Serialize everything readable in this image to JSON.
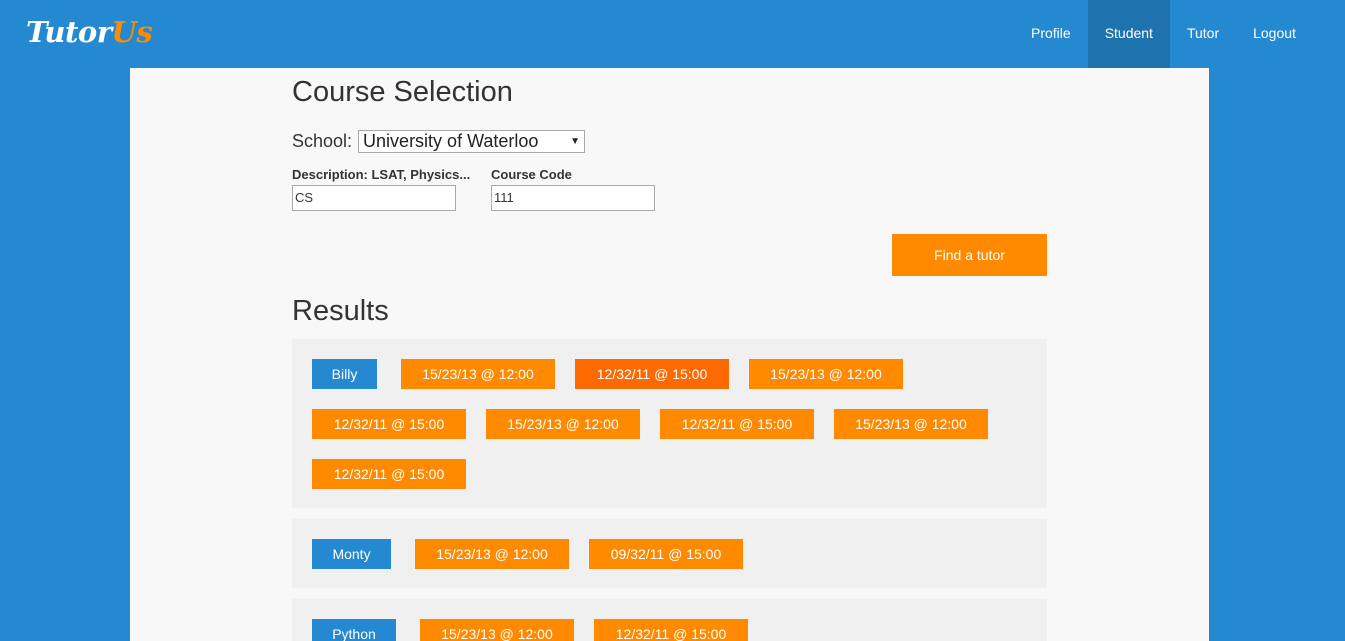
{
  "header": {
    "logo_part1": "Tutor",
    "logo_part2": "Us",
    "nav": [
      {
        "label": "Profile"
      },
      {
        "label": "Student"
      },
      {
        "label": "Tutor"
      },
      {
        "label": "Logout"
      }
    ],
    "active_nav": "Student"
  },
  "course_selection": {
    "title": "Course Selection",
    "school_label": "School:",
    "school_value": "University of Waterloo",
    "description_label": "Description: LSAT, Physics...",
    "description_value": "CS",
    "course_code_label": "Course Code",
    "course_code_value": "111",
    "find_button": "Find a tutor"
  },
  "results": {
    "title": "Results",
    "tutors": [
      {
        "name": "Billy",
        "slots": [
          "15/23/13 @ 12:00",
          "12/32/11 @ 15:00",
          "15/23/13 @ 12:00",
          "12/32/11 @ 15:00",
          "15/23/13 @ 12:00",
          "12/32/11 @ 15:00",
          "15/23/13 @ 12:00",
          "12/32/11 @ 15:00"
        ]
      },
      {
        "name": "Monty",
        "slots": [
          "15/23/13 @ 12:00",
          "09/32/11 @ 15:00"
        ]
      },
      {
        "name": "Python",
        "slots": [
          "15/23/13 @ 12:00",
          "12/32/11 @ 15:00"
        ]
      }
    ]
  },
  "colors": {
    "primary_blue": "#2589d2",
    "active_nav": "#1e72ae",
    "orange": "#ff8a00",
    "orange_active": "#ff6a00",
    "panel_bg": "#f8f8f8",
    "card_bg": "#f0f0f0"
  }
}
